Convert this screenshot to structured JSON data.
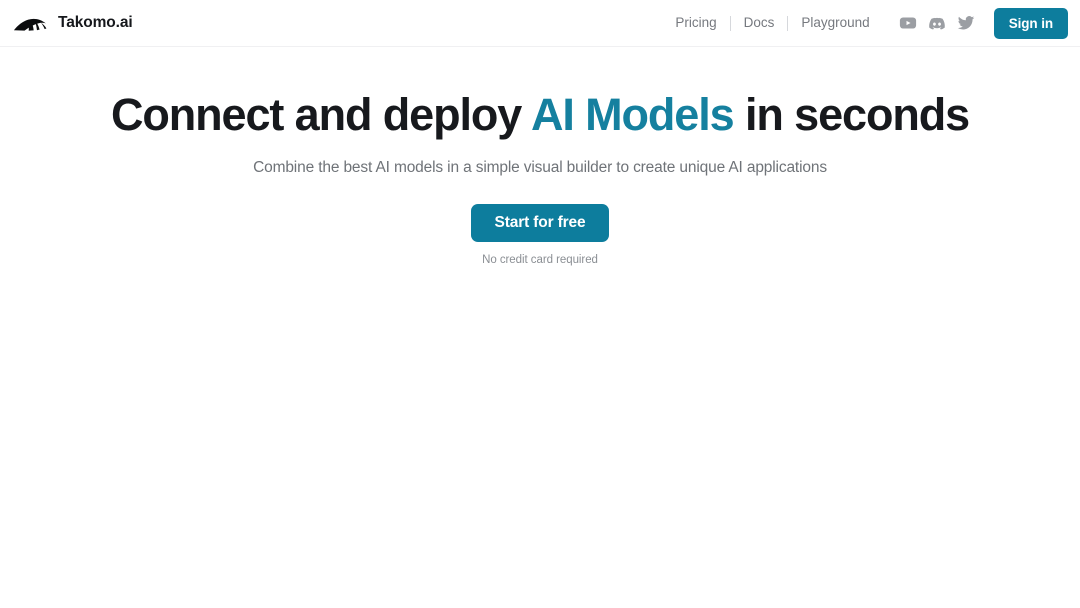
{
  "brand": {
    "name": "Takomo.ai",
    "logo_icon": "takomo-squid-logo-icon"
  },
  "header": {
    "nav_links": [
      {
        "label": "Pricing"
      },
      {
        "label": "Docs"
      },
      {
        "label": "Playground"
      }
    ],
    "social": [
      {
        "name": "youtube-icon",
        "label": "YouTube"
      },
      {
        "name": "discord-icon",
        "label": "Discord"
      },
      {
        "name": "twitter-icon",
        "label": "Twitter"
      }
    ],
    "signin_label": "Sign in"
  },
  "hero": {
    "title_part1": "Connect and deploy ",
    "title_accent": "AI Models",
    "title_part2": " in seconds",
    "subtitle": "Combine the best AI models in a simple visual builder to create unique AI applications",
    "cta_label": "Start for free",
    "cta_note": "No credit card required"
  },
  "colors": {
    "accent": "#0d7d9d",
    "accent_text": "#15809f",
    "heading": "#17191d",
    "body_text": "#6f7378",
    "nav_text": "#76797f",
    "muted": "#8b8f94",
    "border": "#f0f0f2",
    "background": "#ffffff"
  }
}
